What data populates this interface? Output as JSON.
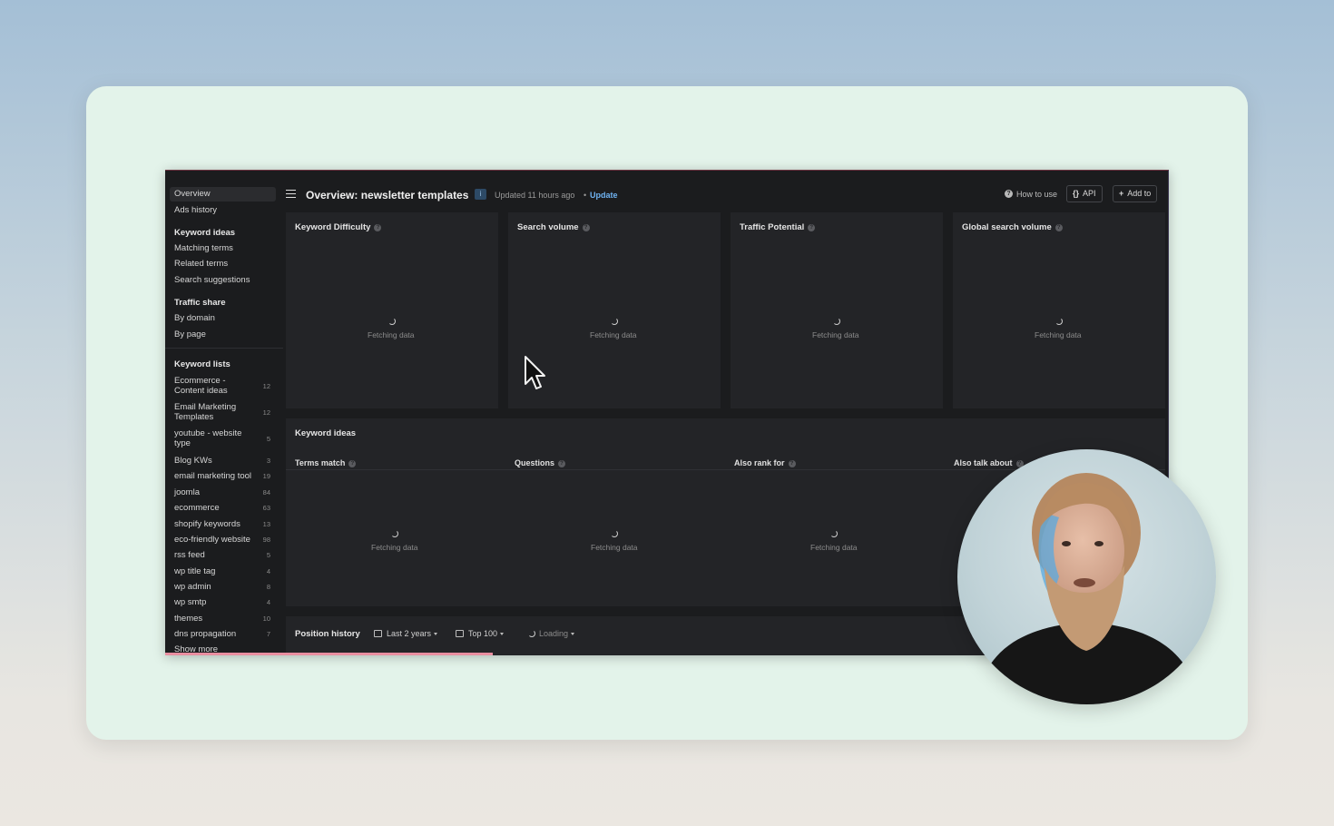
{
  "header": {
    "title": "Overview: newsletter templates",
    "info_badge": "i",
    "updated": "Updated 11 hours ago",
    "separator": "•",
    "update_link": "Update",
    "how_to_use": "How to use",
    "api": "API",
    "api_icon": "{}",
    "add_to": "Add to",
    "add_icon": "+"
  },
  "sidebar": {
    "overview": "Overview",
    "ads_history": "Ads history",
    "keyword_ideas_head": "Keyword ideas",
    "matching_terms": "Matching terms",
    "related_terms": "Related terms",
    "search_suggestions": "Search suggestions",
    "traffic_share_head": "Traffic share",
    "by_domain": "By domain",
    "by_page": "By page",
    "keyword_lists_head": "Keyword lists",
    "lists": [
      {
        "line1": "Ecommerce -",
        "line2": "Content ideas",
        "count": "12"
      },
      {
        "line1": "Email Marketing",
        "line2": "Templates",
        "count": "12"
      },
      {
        "line1": "youtube - website",
        "line2": "type",
        "count": "5"
      },
      {
        "line1": "Blog KWs",
        "count": "3"
      },
      {
        "line1": "email marketing tool",
        "count": "19"
      },
      {
        "line1": "joomla",
        "count": "84"
      },
      {
        "line1": "ecommerce",
        "count": "63"
      },
      {
        "line1": "shopify keywords",
        "count": "13"
      },
      {
        "line1": "eco-friendly website",
        "count": "98"
      },
      {
        "line1": "rss feed",
        "count": "5"
      },
      {
        "line1": "wp title tag",
        "count": "4"
      },
      {
        "line1": "wp admin",
        "count": "8"
      },
      {
        "line1": "wp smtp",
        "count": "4"
      },
      {
        "line1": "themes",
        "count": "10"
      },
      {
        "line1": "dns propagation",
        "count": "7"
      }
    ],
    "show_more": "Show more"
  },
  "metrics": [
    {
      "title": "Keyword Difficulty",
      "status": "Fetching data"
    },
    {
      "title": "Search volume",
      "status": "Fetching data"
    },
    {
      "title": "Traffic Potential",
      "status": "Fetching data"
    },
    {
      "title": "Global search volume",
      "status": "Fetching data"
    }
  ],
  "keyword_ideas": {
    "title": "Keyword ideas",
    "columns": [
      {
        "label": "Terms match",
        "status": "Fetching data"
      },
      {
        "label": "Questions",
        "status": "Fetching data"
      },
      {
        "label": "Also rank for",
        "status": "Fetching data"
      },
      {
        "label": "Also talk about",
        "status": ""
      }
    ]
  },
  "position_history": {
    "title": "Position history",
    "range": "Last 2 years",
    "top": "Top 100",
    "loading": "Loading"
  },
  "help_glyph": "?",
  "icons": [
    "menu-icon",
    "help-circle-icon",
    "code-braces-icon",
    "plus-icon",
    "calendar-icon",
    "list-icon",
    "spinner-icon",
    "mouse-pointer-icon",
    "chevron-down-icon"
  ],
  "colors": {
    "panel_bg": "#232427",
    "screen_bg": "#1b1c1e",
    "link": "#6fb3f2",
    "card_bg": "#e3f3ea"
  }
}
